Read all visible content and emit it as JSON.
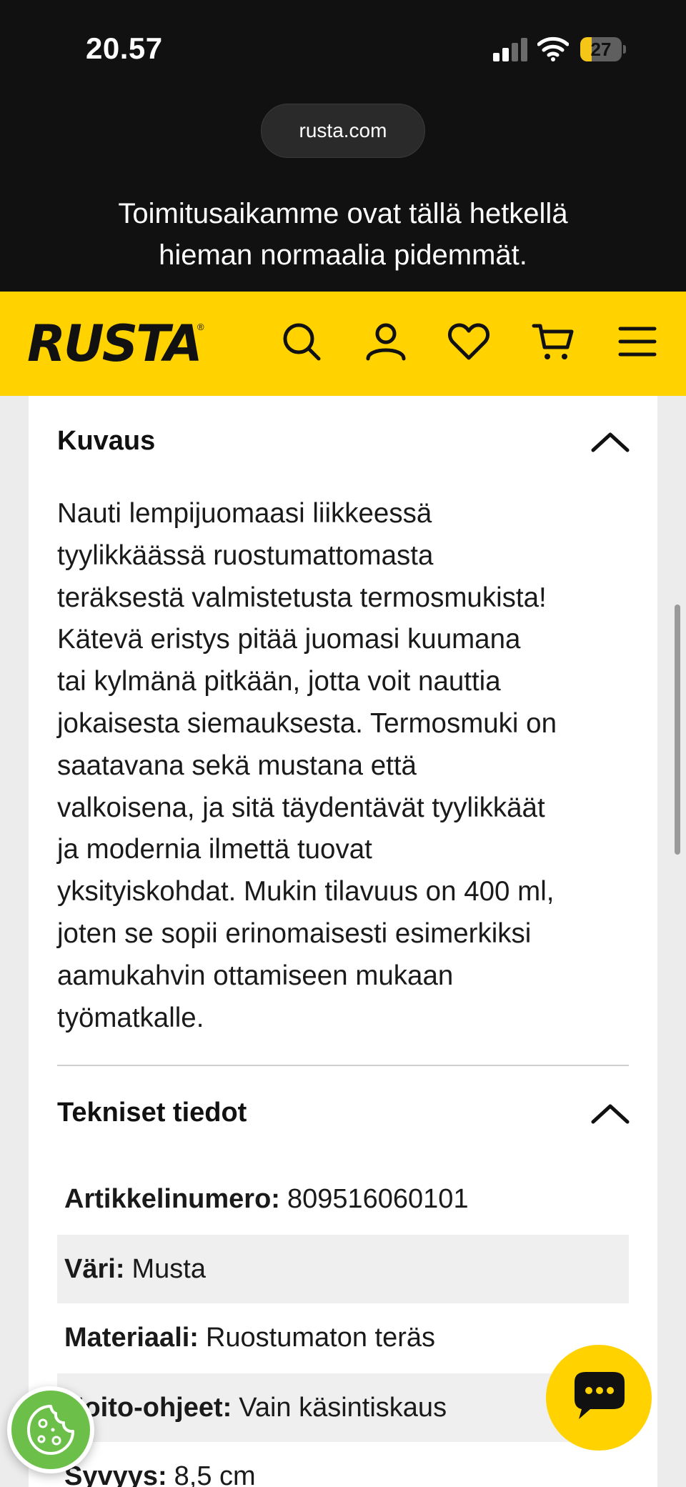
{
  "status_bar": {
    "time": "20.57",
    "battery": "27",
    "battery_level": 0.27,
    "icons": [
      "signal-icon",
      "wifi-icon",
      "battery-icon"
    ]
  },
  "browser": {
    "url": "rusta.com"
  },
  "notice_banner": {
    "line1": "Toimitusaikamme ovat tällä hetkellä",
    "line2": "hieman normaalia pidemmät."
  },
  "header": {
    "logo": "RUSTA",
    "logo_mark": "®",
    "icons": [
      "search-icon",
      "account-icon",
      "heart-icon",
      "cart-icon",
      "menu-icon"
    ],
    "bg_color": "#ffd200"
  },
  "description": {
    "title": "Kuvaus",
    "lines": [
      "Nauti lempijuomaasi liikkeessä",
      "tyylikkäässä ruostumattomasta",
      "teräksestä valmistetusta termosmukista!",
      "Kätevä eristys pitää juomasi kuumana",
      "tai kylmänä pitkään, jotta voit nauttia",
      "jokaisesta siemauksesta. Termosmuki on",
      "saatavana sekä mustana että",
      "valkoisena, ja sitä täydentävät tyylikkäät",
      "ja modernia ilmettä tuovat",
      "yksityiskohdat. Mukin tilavuus on 400 ml,",
      "joten se sopii erinomaisesti esimerkiksi",
      "aamukahvin ottamiseen mukaan",
      "työmatkalle."
    ]
  },
  "tech_specs": {
    "title": "Tekniset tiedot",
    "rows": [
      {
        "label": "Artikkelinumero:",
        "value": "809516060101"
      },
      {
        "label": "Väri:",
        "value": "Musta"
      },
      {
        "label": "Materiaali:",
        "value": "Ruostumaton teräs"
      },
      {
        "label": "Hoito-ohjeet:",
        "value": "Vain käsintiskaus"
      },
      {
        "label": "Syvyys:",
        "value": "8,5 cm"
      }
    ]
  },
  "floating": {
    "cookie_icon": "cookie-icon",
    "chat_icon": "chat-icon"
  }
}
